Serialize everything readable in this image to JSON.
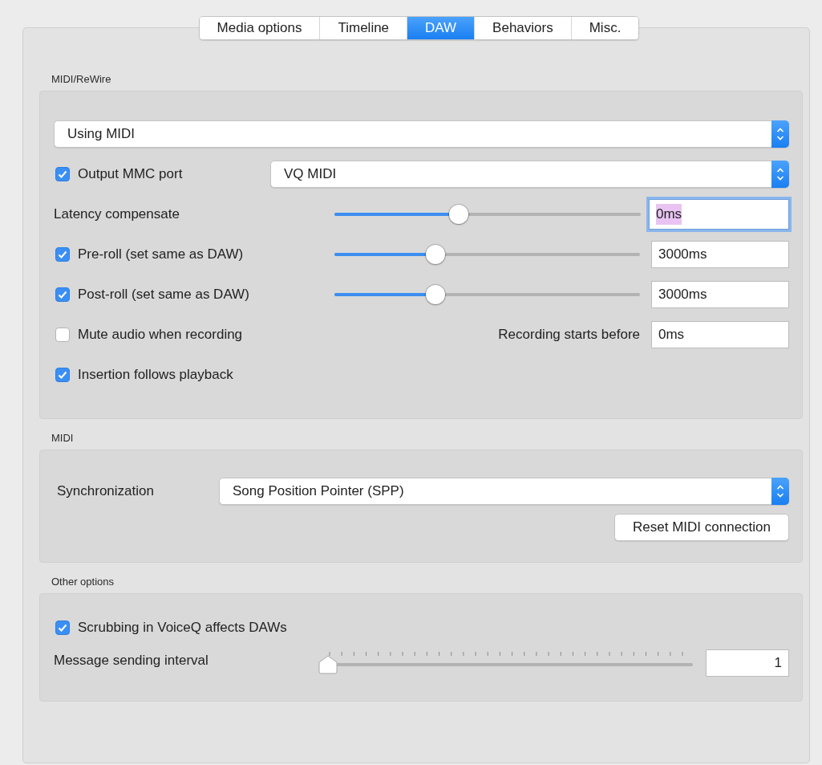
{
  "tabs": [
    {
      "label": "Media options",
      "selected": false
    },
    {
      "label": "Timeline",
      "selected": false
    },
    {
      "label": "DAW",
      "selected": true
    },
    {
      "label": "Behaviors",
      "selected": false
    },
    {
      "label": "Misc.",
      "selected": false
    }
  ],
  "groups": [
    {
      "title": "MIDI/ReWire",
      "rows": [
        {
          "kind": "select",
          "value": "Using MIDI"
        },
        {
          "kind": "checkbox_select",
          "label": "Output MMC port",
          "checked": true,
          "value": "VQ MIDI"
        },
        {
          "kind": "slider",
          "label": "Latency compensate",
          "level": 0.4,
          "field": "0ms",
          "focused": true
        },
        {
          "kind": "checkbox_slider",
          "label": "Pre-roll (set same as DAW)",
          "checked": true,
          "level": 0.32,
          "field": "3000ms",
          "focused": false
        },
        {
          "kind": "checkbox_slider",
          "label": "Post-roll (set same as DAW)",
          "checked": true,
          "level": 0.32,
          "field": "3000ms",
          "focused": false
        },
        {
          "kind": "checkbox_field",
          "label": "Mute audio when recording",
          "checked": false,
          "field_label": "Recording starts before",
          "field": "0ms"
        },
        {
          "kind": "checkbox",
          "label": "Insertion follows playback",
          "checked": true
        }
      ]
    },
    {
      "title": "MIDI",
      "rows": [
        {
          "kind": "labeled_select",
          "label": "Synchronization",
          "value": "Song Position Pointer (SPP)"
        },
        {
          "kind": "button",
          "label": "Reset MIDI connection"
        }
      ]
    },
    {
      "title": "Other options",
      "rows": [
        {
          "kind": "checkbox",
          "label": "Scrubbing in VoiceQ affects DAWs",
          "checked": true
        },
        {
          "kind": "ticked_slider",
          "label": "Message sending interval",
          "level": 0,
          "field": "1"
        }
      ]
    }
  ]
}
